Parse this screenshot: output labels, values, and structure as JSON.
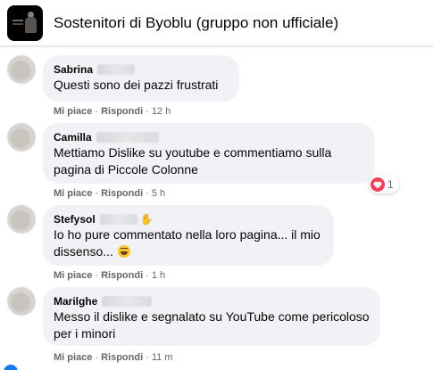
{
  "header": {
    "group_title": "Sostenitori di Byoblu (gruppo non ufficiale)"
  },
  "comments": [
    {
      "author": "Sabrina",
      "text": "Questi sono dei pazzi frustrati",
      "like_label": "Mi piace",
      "reply_label": "Rispondi",
      "time": "12 h"
    },
    {
      "author": "Camilla",
      "text_line1": "Mettiamo Dislike su youtube e commentiamo sulla",
      "text_line2": "pagina di Piccole Colonne",
      "like_label": "Mi piace",
      "reply_label": "Rispondi",
      "time": "5 h",
      "reaction_count": "1"
    },
    {
      "author": "Stefysol",
      "text_line1": "Io ho pure commentato nella loro pagina... il mio",
      "text_line2": "dissenso...",
      "like_label": "Mi piace",
      "reply_label": "Rispondi",
      "time": "1 h"
    },
    {
      "author": "Marilghe",
      "text_line1": "Messo il dislike e segnalato su YouTube come pericoloso",
      "text_line2": "per i minori",
      "like_label": "Mi piace",
      "reply_label": "Rispondi",
      "time": "11 m"
    }
  ],
  "colors": {
    "bubble": "#f0f2f5",
    "meta_text": "#65676b",
    "heart": "#f33e58",
    "accent": "#1877f2"
  },
  "icons": {
    "reaction": "heart-icon",
    "wave": "waving-hand-icon",
    "emoji": "rofl-emoji-icon"
  }
}
